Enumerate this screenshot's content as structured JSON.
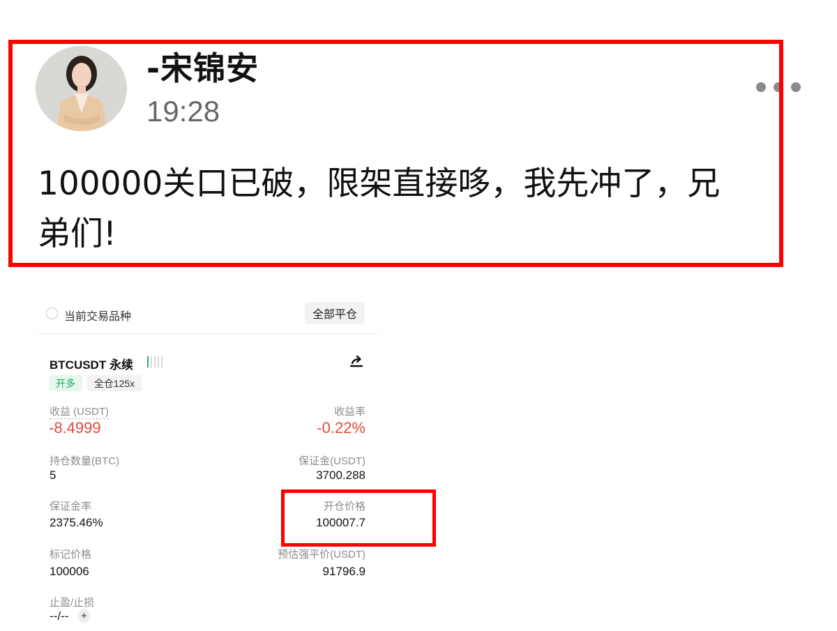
{
  "post": {
    "username": "-宋锦安",
    "time": "19:28",
    "text_line1": "100000关口已破，限架直接哆，我先冲了，兄",
    "text_line2": "弟们!"
  },
  "position": {
    "current_symbol_label": "当前交易品种",
    "close_all_label": "全部平仓",
    "symbol": "BTCUSDT 永续",
    "side_tag": "开多",
    "leverage_tag": "全仓125x",
    "pnl_label": "收益 (USDT)",
    "pnl_value": "-8.4999",
    "roe_label": "收益率",
    "roe_value": "-0.22%",
    "size_label": "持仓数量(BTC)",
    "size_value": "5",
    "margin_label": "保证金(USDT)",
    "margin_value": "3700.288",
    "margin_ratio_label": "保证金率",
    "margin_ratio_value": "2375.46%",
    "entry_price_label": "开仓价格",
    "entry_price_value": "100007.7",
    "mark_price_label": "标记价格",
    "mark_price_value": "100006",
    "liq_price_label": "预估强平价(USDT)",
    "liq_price_value": "91796.9",
    "tpsl_label": "止盈/止损",
    "tpsl_value": "--/--",
    "add_label": "+"
  },
  "colors": {
    "highlight": "#ff0000",
    "negative": "#e2483d",
    "long_green": "#19a85d"
  },
  "icons": {
    "more": "more-dots-icon",
    "share": "share-icon",
    "radio": "radio-icon"
  }
}
